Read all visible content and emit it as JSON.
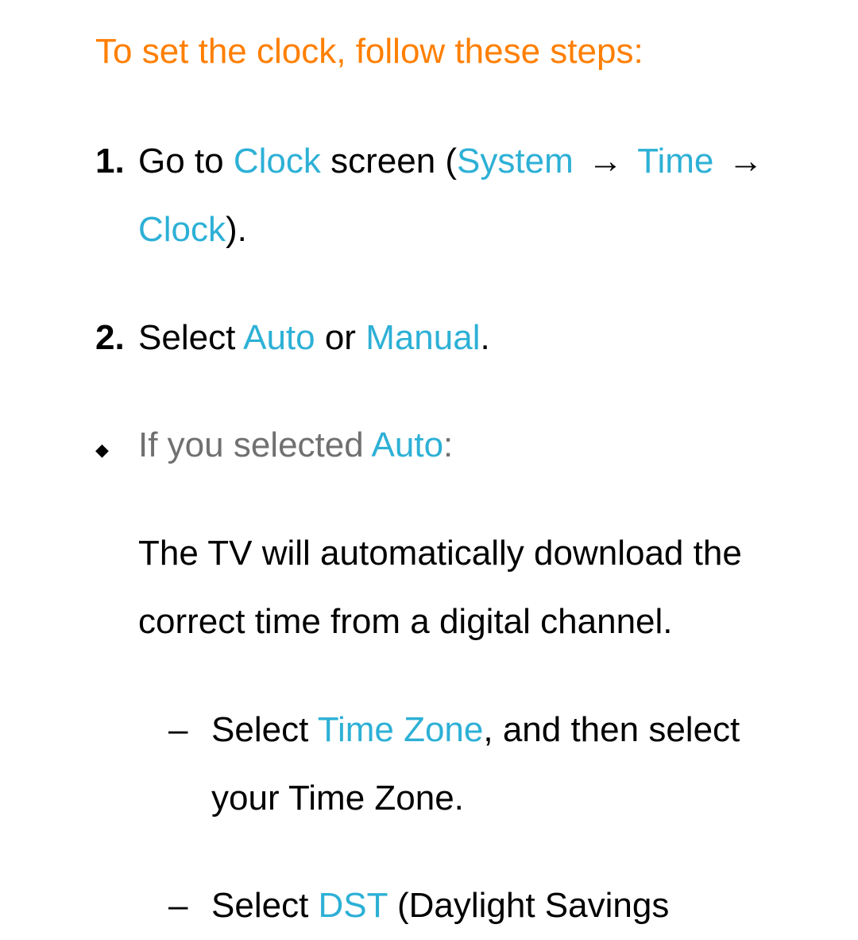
{
  "heading": "To set the clock, follow these steps:",
  "step1": {
    "num": "1.",
    "t1": "Go to ",
    "hl1": "Clock",
    "t2": " screen (",
    "hl2": "System",
    "arrow": " → ",
    "hl3": "Time",
    "hl4": "Clock",
    "t3": ")."
  },
  "step2": {
    "num": "2.",
    "t1": "Select ",
    "hl1": "Auto",
    "t2": " or ",
    "hl2": "Manual",
    "t3": "."
  },
  "bullet": {
    "mark": "◆",
    "lead1": "If you selected ",
    "leadhl": "Auto",
    "lead2": ":",
    "text": "The TV will automatically download the correct time from a digital channel."
  },
  "dash1": {
    "mark": "–",
    "t1": "Select ",
    "hl1": "Time Zone",
    "t2": ", and then select your Time Zone."
  },
  "dash2": {
    "mark": "–",
    "t1": "Select ",
    "hl1": "DST",
    "t2": " (Daylight Savings"
  }
}
